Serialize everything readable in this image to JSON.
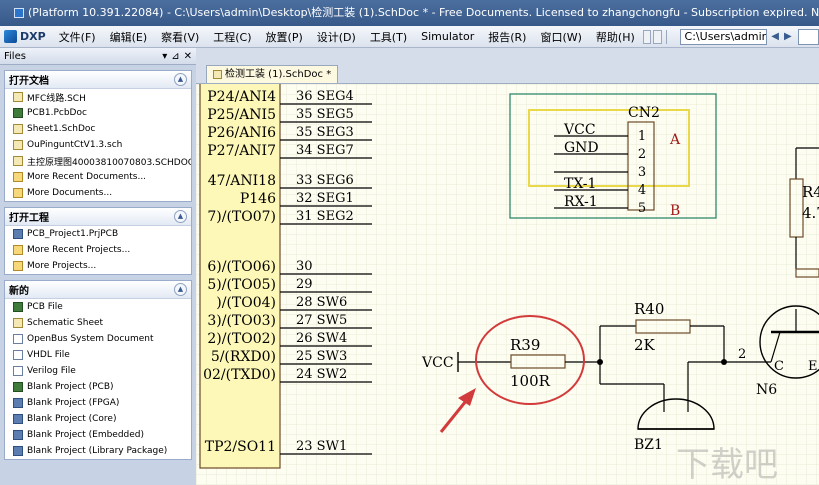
{
  "title_bar": {
    "text": "(Platform 10.391.22084) - C:\\Users\\admin\\Desktop\\检测工装 (1).SchDoc * - Free Documents. Licensed to zhangchongfu - Subscription expired. Not signed in."
  },
  "menu": {
    "app_label": "DXP",
    "items": [
      {
        "label": "文件(F)"
      },
      {
        "label": "编辑(E)"
      },
      {
        "label": "察看(V)"
      },
      {
        "label": "工程(C)"
      },
      {
        "label": "放置(P)"
      },
      {
        "label": "设计(D)"
      },
      {
        "label": "工具(T)"
      },
      {
        "label": "Simulator"
      },
      {
        "label": "报告(R)"
      },
      {
        "label": "窗口(W)"
      },
      {
        "label": "帮助(H)"
      }
    ],
    "path_value": "C:\\Users\\admin\\Desktop\\检测工"
  },
  "panel": {
    "title": "Files",
    "sections": {
      "open_docs": {
        "title": "打开文档",
        "items": [
          {
            "label": "MFC线路.SCH",
            "icon": "schematic-icon"
          },
          {
            "label": "PCB1.PcbDoc",
            "icon": "pcb-icon"
          },
          {
            "label": "Sheet1.SchDoc",
            "icon": "schematic-icon"
          },
          {
            "label": "OuPinguntCtV1.3.sch",
            "icon": "schematic-icon"
          },
          {
            "label": "主控原理图40003810070803.SCHDOC",
            "icon": "schematic-icon"
          },
          {
            "label": "More Recent Documents...",
            "icon": "folder-icon"
          },
          {
            "label": "More Documents...",
            "icon": "folder-icon"
          }
        ]
      },
      "open_projects": {
        "title": "打开工程",
        "items": [
          {
            "label": "PCB_Project1.PrjPCB",
            "icon": "project-icon"
          },
          {
            "label": "More Recent Projects...",
            "icon": "folder-icon"
          },
          {
            "label": "More Projects...",
            "icon": "folder-icon"
          }
        ]
      },
      "new": {
        "title": "新的",
        "items": [
          {
            "label": "PCB File",
            "icon": "pcb-icon"
          },
          {
            "label": "Schematic Sheet",
            "icon": "schematic-icon"
          },
          {
            "label": "OpenBus System Document",
            "icon": "document-icon"
          },
          {
            "label": "VHDL File",
            "icon": "document-icon"
          },
          {
            "label": "Verilog File",
            "icon": "document-icon"
          },
          {
            "label": "Blank Project (PCB)",
            "icon": "pcb-icon"
          },
          {
            "label": "Blank Project (FPGA)",
            "icon": "project-icon"
          },
          {
            "label": "Blank Project (Core)",
            "icon": "project-icon"
          },
          {
            "label": "Blank Project (Embedded)",
            "icon": "project-icon"
          },
          {
            "label": "Blank Project (Library Package)",
            "icon": "project-icon"
          }
        ]
      }
    }
  },
  "tab": {
    "label": "检测工装 (1).SchDoc *"
  },
  "schematic": {
    "ic_pins_left": [
      {
        "name": "P24/ANI4",
        "num": "36",
        "net": "SEG4"
      },
      {
        "name": "P25/ANI5",
        "num": "35",
        "net": "SEG5"
      },
      {
        "name": "P26/ANI6",
        "num": "35",
        "net": "SEG3"
      },
      {
        "name": "P27/ANI7",
        "num": "34",
        "net": "SEG7"
      },
      {
        "name": "47/ANI18",
        "num": "33",
        "net": "SEG6"
      },
      {
        "name": "P146",
        "num": "32",
        "net": "SEG1"
      },
      {
        "name": "7)/(TO07)",
        "num": "31",
        "net": "SEG2"
      },
      {
        "name": "6)/(TO06)",
        "num": "30",
        "net": ""
      },
      {
        "name": "5)/(TO05)",
        "num": "29",
        "net": ""
      },
      {
        "name": ")/(TO04)",
        "num": "28",
        "net": "SW6"
      },
      {
        "name": "3)/(TO03)",
        "num": "27",
        "net": "SW5"
      },
      {
        "name": "2)/(TO02)",
        "num": "26",
        "net": "SW4"
      },
      {
        "name": "5/(RXD0)",
        "num": "25",
        "net": "SW3"
      },
      {
        "name": "02/(TXD0)",
        "num": "24",
        "net": "SW2"
      },
      {
        "name": "TP2/SO11",
        "num": "23",
        "net": "SW1"
      }
    ],
    "connector": {
      "ref": "CN2",
      "pins": [
        "1",
        "2",
        "3",
        "4",
        "5"
      ],
      "nets": [
        "VCC",
        "GND",
        "",
        "TX-1",
        "RX-1"
      ],
      "label_a": "A",
      "label_b": "B"
    },
    "r39": {
      "ref": "R39",
      "value": "100R"
    },
    "r40": {
      "ref": "R40",
      "value": "2K"
    },
    "vcc": "VCC",
    "buzzer": "BZ1",
    "transistor": {
      "ref": "N6",
      "pin_c": "C",
      "pin_e": "E",
      "pin_num": "2"
    },
    "r4_partial": {
      "ref": "R4",
      "value": "4.7"
    },
    "watermark": "下载吧"
  }
}
